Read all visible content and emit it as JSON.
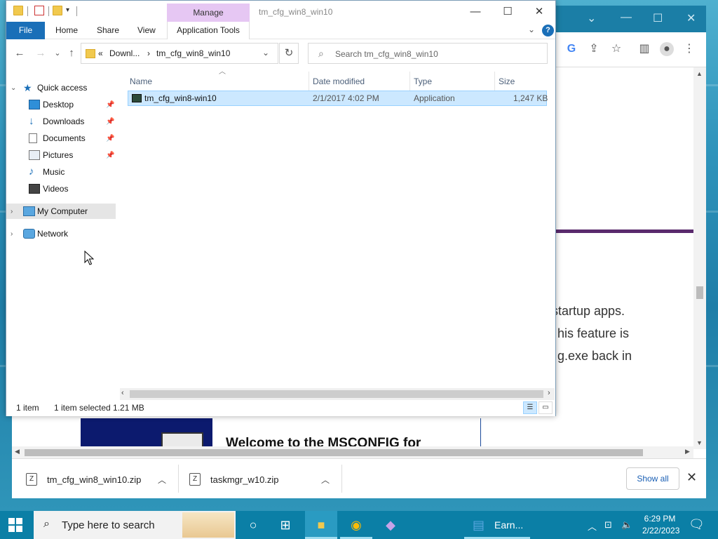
{
  "explorer": {
    "title": "tm_cfg_win8_win10",
    "manage_tab": "Manage",
    "ribbon": {
      "file": "File",
      "home": "Home",
      "share": "Share",
      "view": "View",
      "app_tools": "Application Tools",
      "help": "?"
    },
    "window_controls": {
      "minimize": "—",
      "maximize": "☐",
      "close": "✕"
    },
    "address": {
      "overflow": "«",
      "crumb1": "Downl...",
      "separator": "›",
      "crumb2": "tm_cfg_win8_win10",
      "dropdown": "⌄",
      "refresh": "↻"
    },
    "search_placeholder": "Search tm_cfg_win8_win10",
    "nav": {
      "back": "←",
      "forward": "→",
      "recent": "⌄",
      "up": "↑"
    },
    "nav_pane": {
      "quick_access": "Quick access",
      "items": [
        {
          "label": "Desktop",
          "icon": "desktop-icon",
          "pinned": true
        },
        {
          "label": "Downloads",
          "icon": "download-icon",
          "pinned": true
        },
        {
          "label": "Documents",
          "icon": "document-icon",
          "pinned": true
        },
        {
          "label": "Pictures",
          "icon": "pictures-icon",
          "pinned": true
        },
        {
          "label": "Music",
          "icon": "music-icon",
          "pinned": false
        },
        {
          "label": "Videos",
          "icon": "video-icon",
          "pinned": false
        }
      ],
      "my_computer": "My Computer",
      "network": "Network"
    },
    "columns": {
      "name": "Name",
      "date": "Date modified",
      "type": "Type",
      "size": "Size"
    },
    "files": [
      {
        "name": "tm_cfg_win8-win10",
        "date": "2/1/2017 4:02 PM",
        "type": "Application",
        "size": "1,247 KB"
      }
    ],
    "status": {
      "count": "1 item",
      "selected": "1 item selected  1.21 MB"
    }
  },
  "browser": {
    "web_text": [
      "startup apps.",
      "his feature is",
      "g.exe back in"
    ],
    "heading": "Welcome to the MSCONFIG for",
    "downloads": [
      {
        "name": "tm_cfg_win8_win10.zip"
      },
      {
        "name": "taskmgr_w10.zip"
      }
    ],
    "show_all": "Show all"
  },
  "taskbar": {
    "search_placeholder": "Type here to search",
    "earn_label": "Earn...",
    "time": "6:29 PM",
    "date": "2/22/2023"
  },
  "colors": {
    "accent": "#1a6fb8",
    "manage_tab": "#e6c7f3",
    "selection": "#cce8ff",
    "taskbar": "#0b7fa6"
  }
}
